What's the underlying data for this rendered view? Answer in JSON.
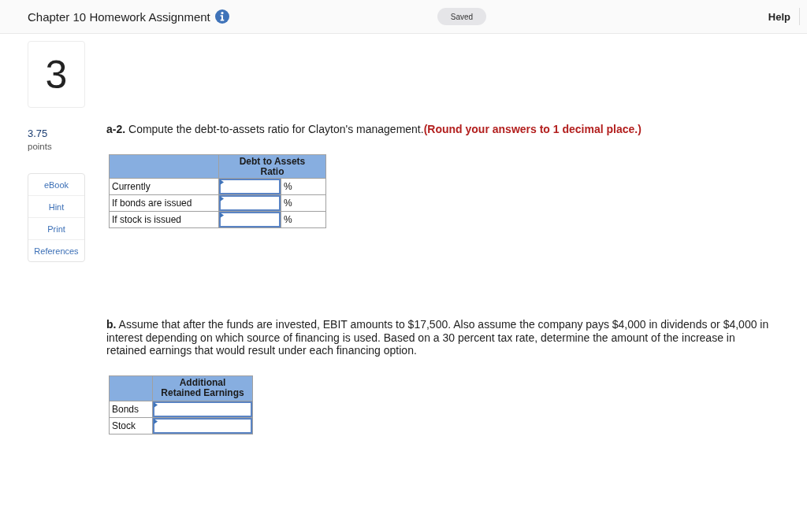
{
  "header": {
    "title": "Chapter 10 Homework Assignment",
    "status": "Saved",
    "help": "Help"
  },
  "question": {
    "number": "3",
    "points": "3.75",
    "points_label": "points"
  },
  "side_tools": [
    "eBook",
    "Hint",
    "Print",
    "References"
  ],
  "part_a": {
    "prompt": "**a-2.** Compute the debt-to-assets ratio for Clayton's management.",
    "instruction": "(Round your answers to 1 decimal place.)",
    "table": {
      "columns": [
        "Debt to Assets Ratio"
      ],
      "rows": [
        {
          "label": "Currently",
          "unit": "%"
        },
        {
          "label": "If bonds are issued",
          "unit": "%"
        },
        {
          "label": "If stock is issued",
          "unit": "%"
        }
      ]
    }
  },
  "part_b": {
    "prompt": "**b.** Assume that after the funds are invested, EBIT amounts to $17,500. Also assume the company pays $4,000 in dividends or $4,000 in interest depending on which source of financing is used. Based on a 30 percent tax rate, determine the amount of the increase in retained earnings that would result under each financing option.",
    "table": {
      "columns": [
        "Additional Retained Earnings"
      ],
      "rows": [
        {
          "label": "Bonds"
        },
        {
          "label": "Stock"
        }
      ]
    }
  }
}
